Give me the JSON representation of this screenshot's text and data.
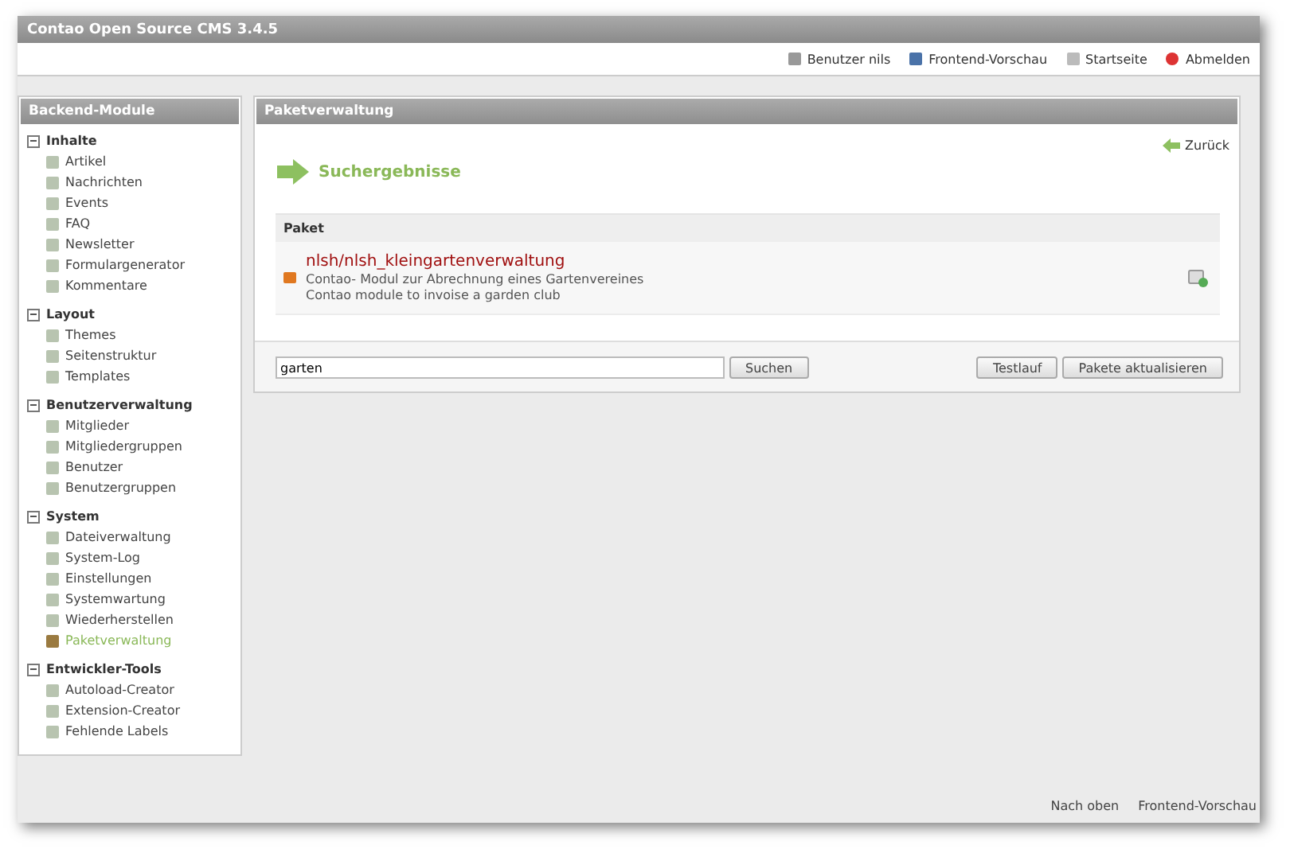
{
  "window": {
    "title": "Contao Open Source CMS 3.4.5"
  },
  "header_links": [
    {
      "kind": "user",
      "label": "Benutzer nils"
    },
    {
      "kind": "preview",
      "label": "Frontend-Vorschau"
    },
    {
      "kind": "home",
      "label": "Startseite"
    },
    {
      "kind": "logout",
      "label": "Abmelden"
    }
  ],
  "sidebar": {
    "title": "Backend-Module",
    "groups": [
      {
        "label": "Inhalte",
        "expanded": true,
        "items": [
          {
            "label": "Artikel",
            "selected": false
          },
          {
            "label": "Nachrichten",
            "selected": false
          },
          {
            "label": "Events",
            "selected": false
          },
          {
            "label": "FAQ",
            "selected": false
          },
          {
            "label": "Newsletter",
            "selected": false
          },
          {
            "label": "Formulargenerator",
            "selected": false
          },
          {
            "label": "Kommentare",
            "selected": false
          }
        ]
      },
      {
        "label": "Layout",
        "expanded": true,
        "items": [
          {
            "label": "Themes",
            "selected": false
          },
          {
            "label": "Seitenstruktur",
            "selected": false
          },
          {
            "label": "Templates",
            "selected": false
          }
        ]
      },
      {
        "label": "Benutzerverwaltung",
        "expanded": true,
        "items": [
          {
            "label": "Mitglieder",
            "selected": false
          },
          {
            "label": "Mitgliedergruppen",
            "selected": false
          },
          {
            "label": "Benutzer",
            "selected": false
          },
          {
            "label": "Benutzergruppen",
            "selected": false
          }
        ]
      },
      {
        "label": "System",
        "expanded": true,
        "items": [
          {
            "label": "Dateiverwaltung",
            "selected": false
          },
          {
            "label": "System-Log",
            "selected": false
          },
          {
            "label": "Einstellungen",
            "selected": false
          },
          {
            "label": "Systemwartung",
            "selected": false
          },
          {
            "label": "Wiederherstellen",
            "selected": false
          },
          {
            "label": "Paketverwaltung",
            "selected": true
          }
        ]
      },
      {
        "label": "Entwickler-Tools",
        "expanded": true,
        "items": [
          {
            "label": "Autoload-Creator",
            "selected": false
          },
          {
            "label": "Extension-Creator",
            "selected": false
          },
          {
            "label": "Fehlende Labels",
            "selected": false
          }
        ]
      }
    ]
  },
  "main": {
    "title": "Paketverwaltung",
    "back_link": "Zurück",
    "heading": "Suchergebnisse",
    "table": {
      "columns": [
        "Paket"
      ],
      "rows": [
        {
          "name": "nlsh/nlsh_kleingartenverwaltung",
          "description_de": "Contao- Modul zur Abrechnung eines Gartenvereines",
          "description_en": "Contao module to invoise a garden club"
        }
      ]
    },
    "search": {
      "value": "garten",
      "button": "Suchen"
    },
    "buttons": [
      "Testlauf",
      "Pakete aktualisieren"
    ]
  },
  "footer_links": [
    "Nach oben",
    "Frontend-Vorschau"
  ]
}
